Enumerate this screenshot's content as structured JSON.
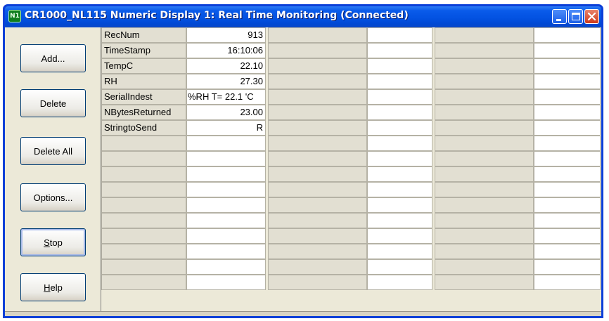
{
  "window": {
    "title": "CR1000_NL115 Numeric Display 1: Real Time Monitoring (Connected)",
    "icon_text": "N1"
  },
  "sidebar": {
    "buttons": [
      {
        "label": "Add...",
        "name": "add-button"
      },
      {
        "label": "Delete",
        "name": "delete-button"
      },
      {
        "label": "Delete All",
        "name": "delete-all-button"
      },
      {
        "label": "Options...",
        "name": "options-button"
      },
      {
        "label": "Stop",
        "name": "stop-button"
      },
      {
        "label": "Help",
        "name": "help-button"
      }
    ]
  },
  "grid": {
    "rows": [
      {
        "name": "RecNum",
        "value": "913"
      },
      {
        "name": "TimeStamp",
        "value": "16:10:06"
      },
      {
        "name": "TempC",
        "value": "22.10"
      },
      {
        "name": "RH",
        "value": "27.30"
      },
      {
        "name": "SerialIndest",
        "value": "%RH T= 22.1 'C"
      },
      {
        "name": "NBytesReturned",
        "value": "23.00"
      },
      {
        "name": "StringtoSend",
        "value": "R"
      }
    ]
  },
  "colors": {
    "titlebar": "#0352e2",
    "client": "#ece9d8",
    "name_cell": "#e2dfd2",
    "value_cell": "#ffffff"
  }
}
